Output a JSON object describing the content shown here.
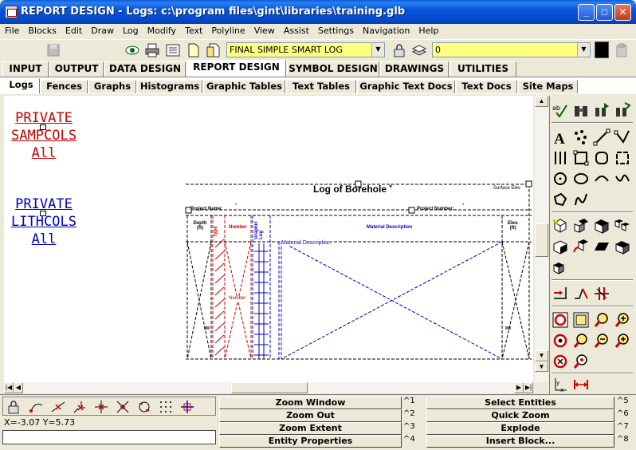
{
  "window": {
    "title": "REPORT DESIGN - Logs:  c:\\program files\\gint\\libraries\\training.glb",
    "minimize": "_",
    "maximize": "□",
    "close": "✕"
  },
  "menu": [
    "File",
    "Blocks",
    "Edit",
    "Draw",
    "Log",
    "Modify",
    "Text",
    "Polyline",
    "View",
    "Assist",
    "Settings",
    "Navigation",
    "Help"
  ],
  "toolbar": {
    "report_select": "FINAL SIMPLE SMART LOG",
    "layer_select": "0"
  },
  "main_tabs": [
    "INPUT",
    "OUTPUT",
    "DATA DESIGN",
    "REPORT DESIGN",
    "SYMBOL DESIGN",
    "DRAWINGS",
    "UTILITIES"
  ],
  "sub_tabs": [
    "Logs",
    "Fences",
    "Graphs",
    "Histograms",
    "Graphic Tables",
    "Text Tables",
    "Graphic Text Docs",
    "Text Docs",
    "Site Maps"
  ],
  "canvas": {
    "block1": [
      "PRIVATE",
      "SAMPCOLS",
      "All"
    ],
    "block2": [
      "PRIVATE",
      "LITHCOLS",
      "All"
    ],
    "log_title": "Log of Borehole",
    "title_mark": "*",
    "surface_elev": "Surface Elev",
    "project_name": "Project Name:",
    "project_number": "Project Number:",
    "columns": {
      "depth": "Depth",
      "depth_unit": "(ft)",
      "type": "Type",
      "number": "Number",
      "graphic_log": "Graphic Log",
      "material": "Material Description",
      "elev": "Elev.",
      "elev_unit": "(ft)"
    },
    "material_desc_field": "Material Description",
    "number_field": "Number",
    "star": "*"
  },
  "status": {
    "coords": "X=-3.07   Y=5.73"
  },
  "commands": [
    {
      "label": "Zoom Window",
      "key": "^1"
    },
    {
      "label": "Zoom Out",
      "key": "^2"
    },
    {
      "label": "Zoom Extent",
      "key": "^3"
    },
    {
      "label": "Entity Properties",
      "key": "^4"
    },
    {
      "label": "Select Entities",
      "key": "^5"
    },
    {
      "label": "Quick Zoom",
      "key": "^6"
    },
    {
      "label": "Explode",
      "key": "^7"
    },
    {
      "label": "Insert Block...",
      "key": "^8"
    }
  ],
  "colors": {
    "red_text": "#c00000",
    "blue_text": "#0000c0",
    "toolbar_combo": "#ffff80"
  }
}
